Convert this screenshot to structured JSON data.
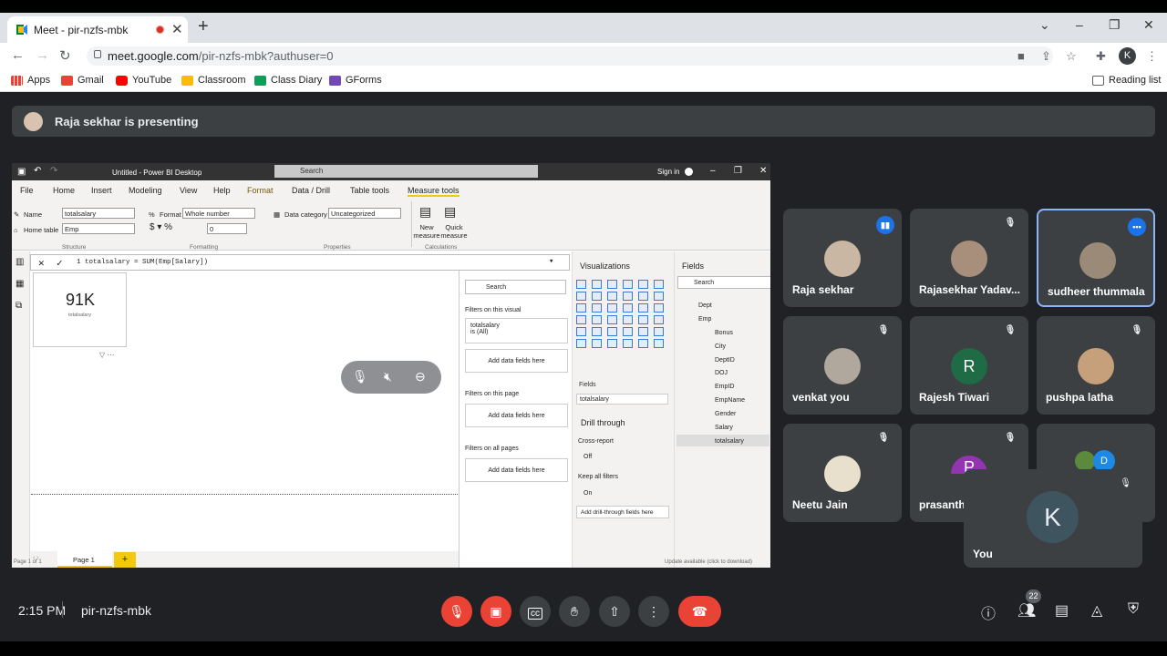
{
  "browser": {
    "tab_title": "Meet - pir-nzfs-mbk",
    "url_host": "meet.google.com",
    "url_path": "/pir-nzfs-mbk?authuser=0",
    "profile_letter": "K",
    "reading_list": "Reading list",
    "bookmarks": [
      "Apps",
      "Gmail",
      "YouTube",
      "Classroom",
      "Class Diary",
      "GForms"
    ]
  },
  "meet": {
    "presenter_text": "Raja sekhar is presenting",
    "time": "2:15 PM",
    "meeting_id": "pir-nzfs-mbk",
    "participant_count": "22",
    "self_letter": "K",
    "self_name": "You",
    "participants": [
      {
        "name": "Raja sekhar"
      },
      {
        "name": "Rajasekhar Yadav..."
      },
      {
        "name": "sudheer thummala"
      },
      {
        "name": "venkat you"
      },
      {
        "name": "Rajesh Tiwari",
        "letter": "R"
      },
      {
        "name": "pushpa latha"
      },
      {
        "name": "Neetu Jain"
      },
      {
        "name": "prasanth",
        "letter": "P"
      },
      {
        "letter": "D"
      }
    ],
    "colors": {
      "accent": "#1a73e8",
      "danger": "#ea4335",
      "tile": "#3c4043",
      "bg": "#202124"
    }
  },
  "pbi": {
    "window_title": "Untitled - Power BI Desktop",
    "search": "Search",
    "sign_in": "Sign in",
    "tabs": [
      "File",
      "Home",
      "Insert",
      "Modeling",
      "View",
      "Help",
      "Format",
      "Data / Drill",
      "Table tools",
      "Measure tools"
    ],
    "ribbon": {
      "name_label": "Name",
      "name_value": "totalsalary",
      "home_table_label": "Home table",
      "home_table_value": "Emp",
      "format_label": "Format",
      "format_value": "Whole number",
      "decimals": "0",
      "data_category_label": "Data category",
      "data_category_value": "Uncategorized",
      "new_measure": "New measure",
      "quick_measure": "Quick measure",
      "group_structure": "Structure",
      "group_formatting": "Formatting",
      "group_properties": "Properties",
      "group_calculations": "Calculations"
    },
    "formula": "1  totalsalary = SUM(Emp[Salary])",
    "card_value": "91K",
    "card_label": "totalsalary",
    "filters": {
      "search": "Search",
      "on_visual": "Filters on this visual",
      "visual_field": "totalsalary",
      "visual_field_state": "is (All)",
      "add_fields": "Add data fields here",
      "on_page": "Filters on this page",
      "on_all": "Filters on all pages"
    },
    "viz": {
      "title": "Visualizations",
      "fields_label": "Fields",
      "field_value": "totalsalary",
      "drill_through": "Drill through",
      "cross_report": "Cross-report",
      "off": "Off",
      "keep_filters": "Keep all filters",
      "on": "On",
      "add_drill": "Add drill-through fields here"
    },
    "fields": {
      "title": "Fields",
      "search": "Search",
      "tables": [
        "Dept",
        "Emp"
      ],
      "emp_fields": [
        "Bonus",
        "City",
        "DeptID",
        "DOJ",
        "EmpID",
        "EmpName",
        "Gender",
        "Salary",
        "totalsalary"
      ]
    },
    "page_tab": "Page 1",
    "status_left": "Page 1 of 1",
    "status_right": "Update available (click to download)"
  }
}
